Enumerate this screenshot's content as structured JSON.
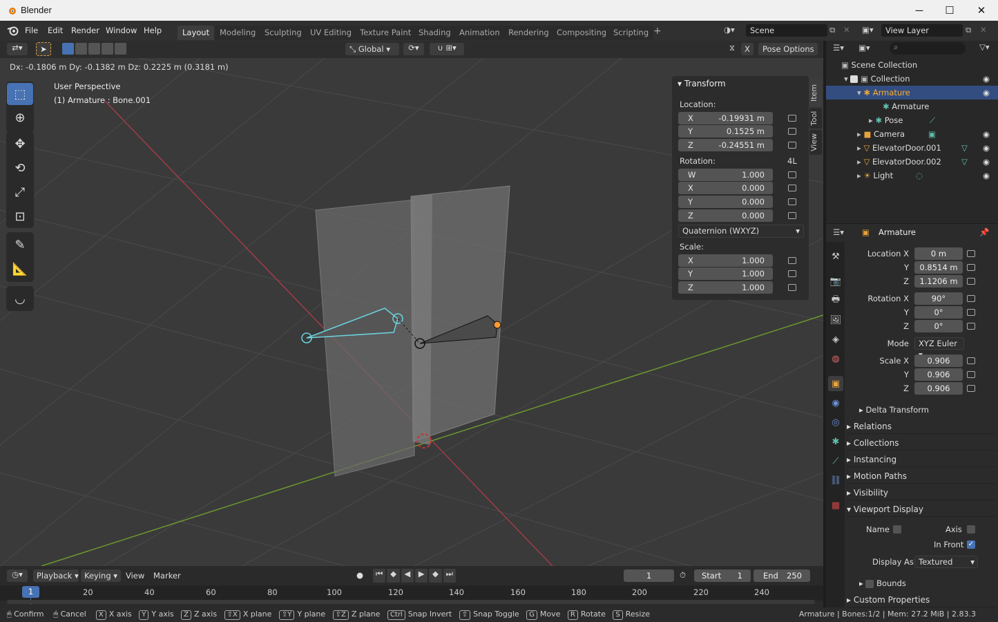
{
  "window": {
    "title": "Blender",
    "minimize": "─",
    "maximize": "☐",
    "close": "✕"
  },
  "menu": [
    "File",
    "Edit",
    "Render",
    "Window",
    "Help"
  ],
  "workspaces": [
    "Layout",
    "Modeling",
    "Sculpting",
    "UV Editing",
    "Texture Paint",
    "Shading",
    "Animation",
    "Rendering",
    "Compositing",
    "Scripting"
  ],
  "workspace_add": "+",
  "scene": {
    "name": "Scene",
    "view_layer": "View Layer"
  },
  "header": {
    "orientation": "Global",
    "pose_options": "Pose Options",
    "x_mirror": "X"
  },
  "viewport": {
    "status": "Dx: -0.1806 m   Dy: -0.1382 m   Dz: 0.2225 m (0.3181 m)",
    "view_name": "User Perspective",
    "active": "(1) Armature : Bone.001"
  },
  "npanel": {
    "title": "Transform",
    "location_label": "Location:",
    "location": [
      {
        "k": "X",
        "v": "-0.19931 m"
      },
      {
        "k": "Y",
        "v": "0.1525 m"
      },
      {
        "k": "Z",
        "v": "-0.24551 m"
      }
    ],
    "rotation_label": "Rotation:",
    "rotation_mode_tag": "4L",
    "rotation": [
      {
        "k": "W",
        "v": "1.000"
      },
      {
        "k": "X",
        "v": "0.000"
      },
      {
        "k": "Y",
        "v": "0.000"
      },
      {
        "k": "Z",
        "v": "0.000"
      }
    ],
    "rotation_mode": "Quaternion (WXYZ)",
    "scale_label": "Scale:",
    "scale": [
      {
        "k": "X",
        "v": "1.000"
      },
      {
        "k": "Y",
        "v": "1.000"
      },
      {
        "k": "Z",
        "v": "1.000"
      }
    ],
    "tabs": [
      "Item",
      "Tool",
      "View"
    ]
  },
  "outliner": {
    "rows": [
      {
        "label": "Scene Collection"
      },
      {
        "label": "Collection"
      },
      {
        "label": "Armature"
      },
      {
        "label": "Armature"
      },
      {
        "label": "Pose"
      },
      {
        "label": "Camera"
      },
      {
        "label": "ElevatorDoor.001"
      },
      {
        "label": "ElevatorDoor.002"
      },
      {
        "label": "Light"
      }
    ]
  },
  "properties": {
    "object_name": "Armature",
    "location_x_label": "Location X",
    "location": [
      "0 m",
      "0.8514 m",
      "1.1206 m"
    ],
    "rotation_x_label": "Rotation X",
    "rotation": [
      "90°",
      "0°",
      "0°"
    ],
    "mode_label": "Mode",
    "mode": "XYZ Euler",
    "scale_x_label": "Scale X",
    "scale": [
      "0.906",
      "0.906",
      "0.906"
    ],
    "y_label": "Y",
    "z_label": "Z",
    "delta": "Delta Transform",
    "sections": [
      "Relations",
      "Collections",
      "Instancing",
      "Motion Paths",
      "Visibility"
    ],
    "viewport_display": "Viewport Display",
    "name_label": "Name",
    "axis_label": "Axis",
    "in_front_label": "In Front",
    "display_as_label": "Display As",
    "display_as": "Textured",
    "bounds_label": "Bounds",
    "custom_props": "Custom Properties"
  },
  "timeline": {
    "menus": [
      "Playback",
      "Keying",
      "View",
      "Marker"
    ],
    "current_frame": "1",
    "start_label": "Start",
    "start": "1",
    "end_label": "End",
    "end": "250",
    "ruler": [
      "20",
      "40",
      "60",
      "80",
      "100",
      "120",
      "140",
      "160",
      "180",
      "200",
      "220",
      "240"
    ],
    "cursor": "1"
  },
  "statusbar": {
    "items": [
      {
        "key": "",
        "label": "Confirm"
      },
      {
        "key": "",
        "label": "Cancel"
      },
      {
        "key": "X",
        "label": "X axis"
      },
      {
        "key": "Y",
        "label": "Y axis"
      },
      {
        "key": "Z",
        "label": "Z axis"
      },
      {
        "key": "⇧X",
        "label": "X plane"
      },
      {
        "key": "⇧Y",
        "label": "Y plane"
      },
      {
        "key": "⇧Z",
        "label": "Z plane"
      },
      {
        "key": "Ctrl",
        "label": "Snap Invert"
      },
      {
        "key": "⇧",
        "label": "Snap Toggle"
      },
      {
        "key": "G",
        "label": "Move"
      },
      {
        "key": "R",
        "label": "Rotate"
      },
      {
        "key": "S",
        "label": "Resize"
      }
    ],
    "info": "Armature | Bones:1/2 | Mem: 27.2 MiB | 2.83.3"
  },
  "colors": {
    "accent": "#4772b3",
    "selected_bone": "#6ad4e0",
    "active_text": "#ffaf29",
    "x_axis": "#a33b48",
    "y_axis": "#6b9a2e"
  }
}
